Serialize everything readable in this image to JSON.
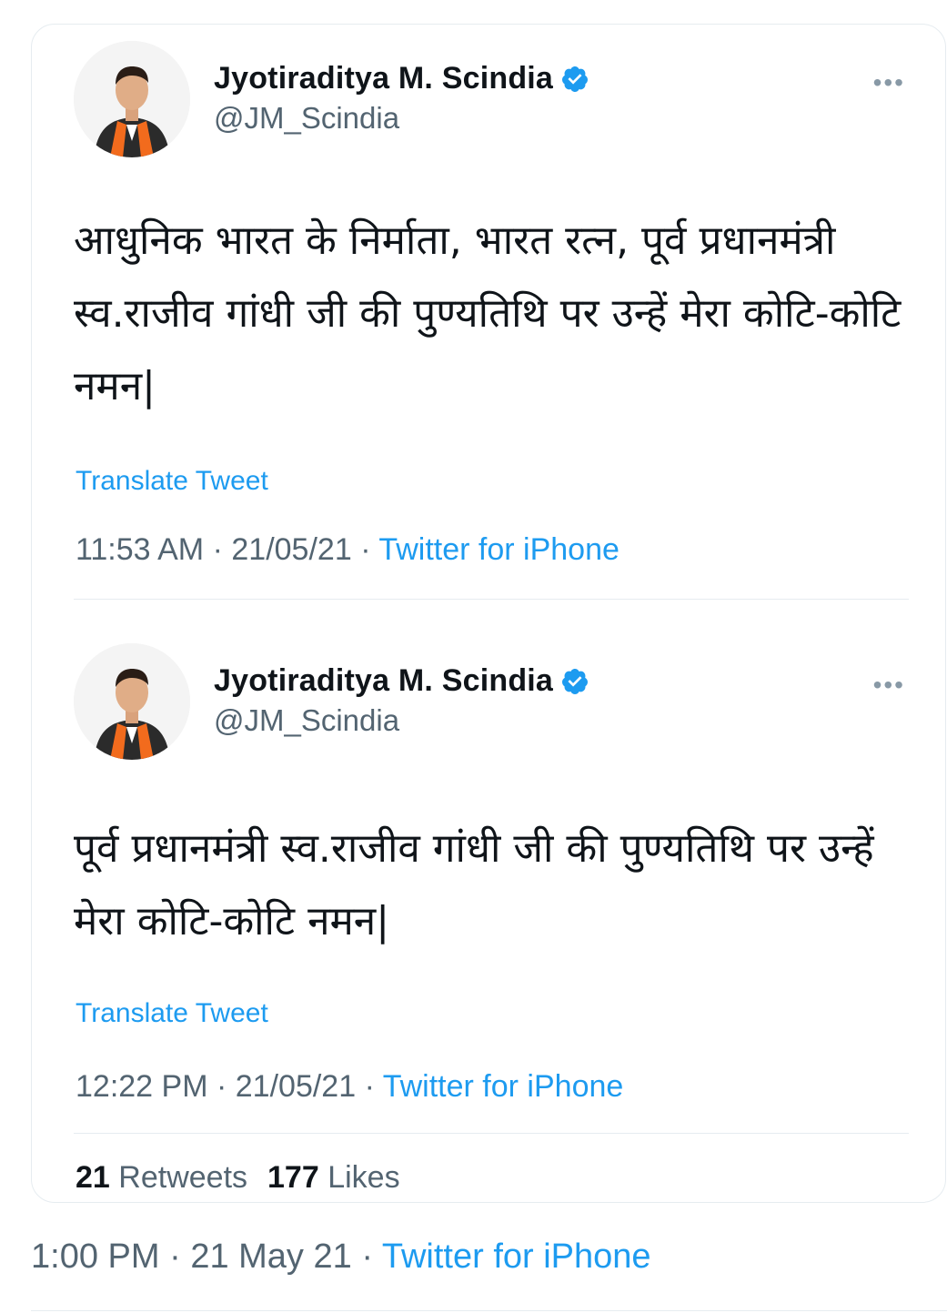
{
  "tweets": [
    {
      "author_name": "Jyotiraditya M. Scindia",
      "handle": "@JM_Scindia",
      "avatar_icon": "profile-photo",
      "verified_icon": "verified-badge-icon",
      "more_icon": "more-icon",
      "text": "आधुनिक भारत के निर्माता, भारत रत्न, पूर्व प्रधानमंत्री स्व.राजीव गांधी जी की पुण्यतिथि पर उन्हें मेरा कोटि-कोटि नमन|",
      "translate_label": "Translate Tweet",
      "time": "11:53 AM",
      "date": "21/05/21",
      "source": "Twitter for iPhone"
    },
    {
      "author_name": "Jyotiraditya M. Scindia",
      "handle": "@JM_Scindia",
      "avatar_icon": "profile-photo",
      "verified_icon": "verified-badge-icon",
      "more_icon": "more-icon",
      "text": "पूर्व प्रधानमंत्री स्व.राजीव गांधी जी की पुण्यतिथि पर उन्हें मेरा कोटि-कोटि नमन|",
      "translate_label": "Translate Tweet",
      "time": "12:22 PM",
      "date": "21/05/21",
      "source": "Twitter for iPhone",
      "retweets_count": "21",
      "retweets_label": "Retweets",
      "likes_count": "177",
      "likes_label": "Likes"
    }
  ],
  "outer_meta": {
    "time": "1:00 PM",
    "date": "21 May 21",
    "source": "Twitter for iPhone"
  },
  "colors": {
    "accent": "#1d9bf0",
    "text": "#0f1419",
    "secondary": "#536471",
    "border": "#e6ecf0"
  }
}
